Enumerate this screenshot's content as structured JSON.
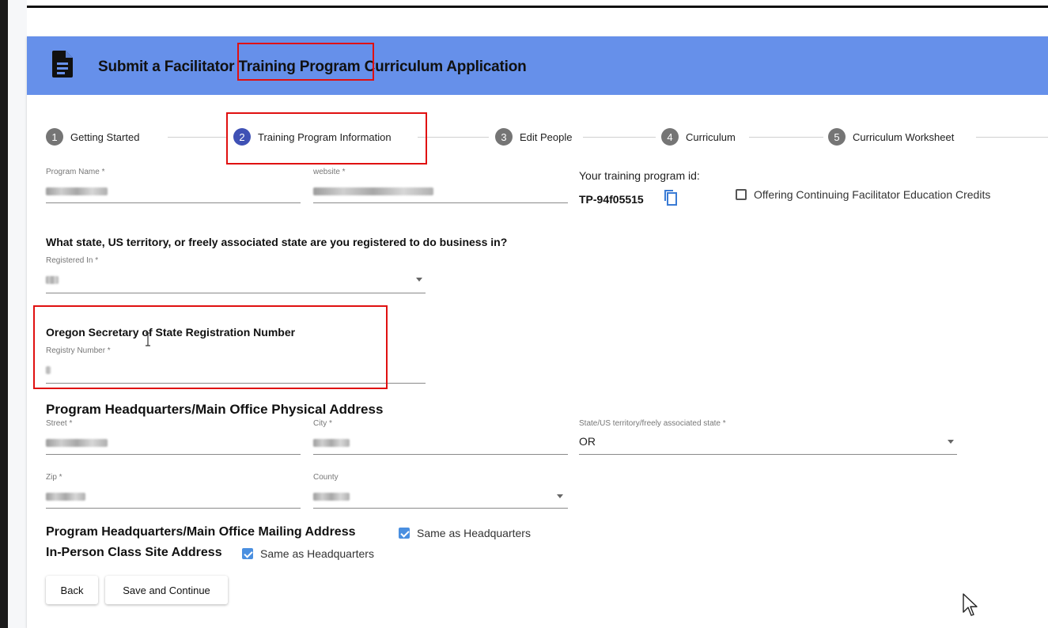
{
  "header": {
    "title": "Submit a Facilitator Training Program Curriculum Application"
  },
  "stepper": {
    "steps": [
      {
        "num": "1",
        "label": "Getting Started"
      },
      {
        "num": "2",
        "label": "Training Program Information"
      },
      {
        "num": "3",
        "label": "Edit People"
      },
      {
        "num": "4",
        "label": "Curriculum"
      },
      {
        "num": "5",
        "label": "Curriculum Worksheet"
      }
    ]
  },
  "form": {
    "program_name": {
      "label": "Program Name *",
      "value": ""
    },
    "website": {
      "label": "website *",
      "value": ""
    },
    "program_id": {
      "label": "Your training program id:",
      "value": "TP-94f05515"
    },
    "cfe_credits": {
      "label": "Offering Continuing Facilitator Education Credits",
      "checked": false
    },
    "registered_question": "What state, US territory, or freely associated state are you registered to do business in?",
    "registered_in": {
      "label": "Registered In *",
      "value": ""
    },
    "sos_heading": "Oregon Secretary of State Registration Number",
    "registry_number": {
      "label": "Registry Number *",
      "value": ""
    },
    "physical_address_heading": "Program Headquarters/Main Office Physical Address",
    "street": {
      "label": "Street *",
      "value": ""
    },
    "city": {
      "label": "City *",
      "value": ""
    },
    "state": {
      "label": "State/US territory/freely associated state *",
      "value": "OR"
    },
    "zip": {
      "label": "Zip *",
      "value": ""
    },
    "county": {
      "label": "County",
      "value": ""
    },
    "mailing_heading": "Program Headquarters/Main Office Mailing Address",
    "mailing_same": {
      "label": "Same as Headquarters",
      "checked": true
    },
    "class_site_heading": "In-Person Class Site Address",
    "class_site_same": {
      "label": "Same as Headquarters",
      "checked": true
    }
  },
  "buttons": {
    "back": "Back",
    "save_continue": "Save and Continue"
  },
  "colors": {
    "header_bg": "#6690ea",
    "active_step": "#3f51b5",
    "highlight": "#e01010",
    "checkbox": "#4a8fe0"
  }
}
